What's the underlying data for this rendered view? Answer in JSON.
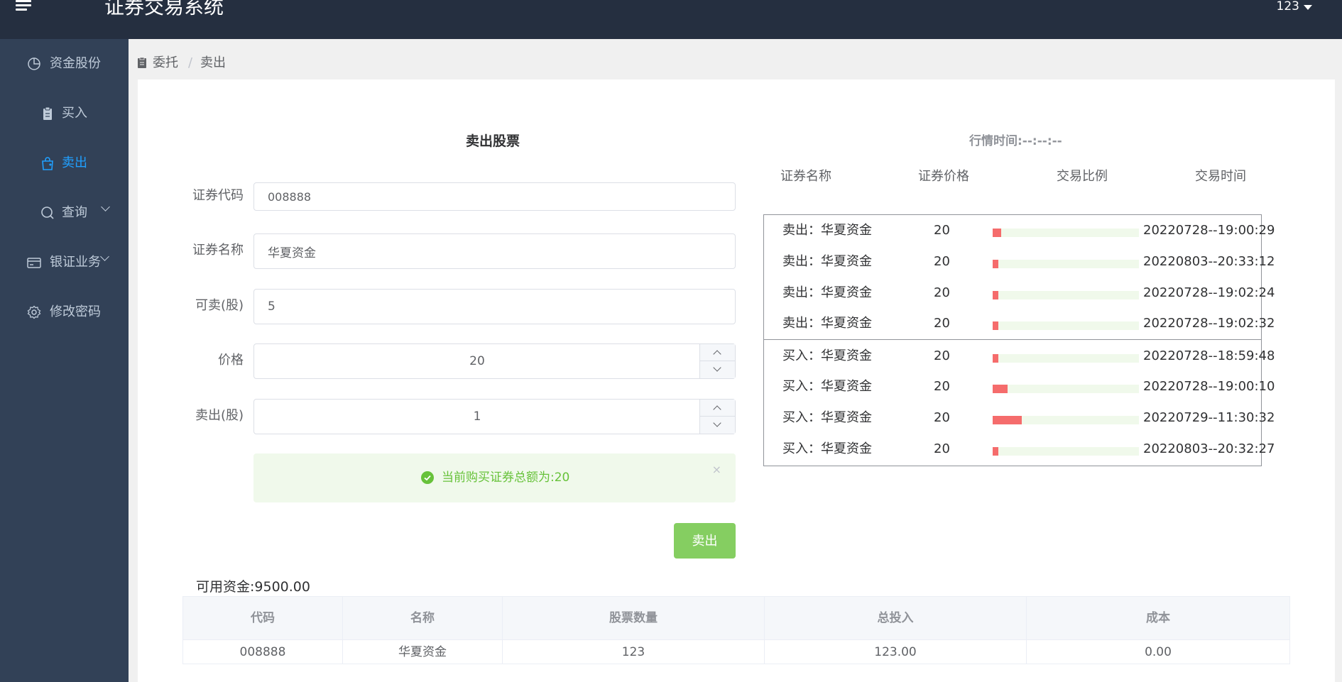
{
  "header": {
    "app_title": "证券交易系统",
    "user_name": "123"
  },
  "sidebar": {
    "items": [
      {
        "label": "资金股份",
        "icon": "pie-chart-icon"
      },
      {
        "label": "买入",
        "icon": "clipboard-icon"
      },
      {
        "label": "卖出",
        "icon": "shopping-bag-icon",
        "active": true
      },
      {
        "label": "查询",
        "icon": "search-icon",
        "has_submenu": true
      },
      {
        "label": "银证业务",
        "icon": "bank-card-icon",
        "has_submenu": true
      },
      {
        "label": "修改密码",
        "icon": "gear-icon"
      }
    ]
  },
  "breadcrumb": {
    "items": [
      "委托",
      "卖出"
    ],
    "separator": "/"
  },
  "form": {
    "title": "卖出股票",
    "code_label": "证券代码",
    "code_value": "008888",
    "name_label": "证券名称",
    "name_value": "华夏资金",
    "available_label": "可卖(股)",
    "available_value": "5",
    "price_label": "价格",
    "price_value": "20",
    "quantity_label": "卖出(股)",
    "quantity_value": "1",
    "alert_text": "当前购买证券总额为:20",
    "alert_close": "×",
    "sell_button": "卖出"
  },
  "funds": {
    "text": "可用资金:9500.00"
  },
  "holdings": {
    "columns": [
      "代码",
      "名称",
      "股票数量",
      "总投入",
      "成本"
    ],
    "rows": [
      [
        "008888",
        "华夏资金",
        "123",
        "123.00",
        "0.00"
      ]
    ]
  },
  "market": {
    "title": "行情时间:--:--:--",
    "columns": [
      "证券名称",
      "证券价格",
      "交易比例",
      "交易时间"
    ],
    "sell_rows": [
      {
        "name": "卖出：华夏资金",
        "price": "20",
        "ratio": 0.012,
        "time": "20220728--19:00:29"
      },
      {
        "name": "卖出：华夏资金",
        "price": "20",
        "ratio": 0.008,
        "time": "20220803--20:33:12"
      },
      {
        "name": "卖出：华夏资金",
        "price": "20",
        "ratio": 0.008,
        "time": "20220728--19:02:24"
      },
      {
        "name": "卖出：华夏资金",
        "price": "20",
        "ratio": 0.008,
        "time": "20220728--19:02:32"
      }
    ],
    "buy_rows": [
      {
        "name": "买入：华夏资金",
        "price": "20",
        "ratio": 0.008,
        "time": "20220728--18:59:48"
      },
      {
        "name": "买入：华夏资金",
        "price": "20",
        "ratio": 0.02,
        "time": "20220728--19:00:10"
      },
      {
        "name": "买入：华夏资金",
        "price": "20",
        "ratio": 0.04,
        "time": "20220729--11:30:32"
      },
      {
        "name": "买入：华夏资金",
        "price": "20",
        "ratio": 0.008,
        "time": "20220803--20:32:27"
      }
    ],
    "bar_fill_color": "#f56c6c",
    "bar_track_color": "#f0f9eb"
  },
  "colors": {
    "header_bg": "#252f40",
    "sidebar_bg": "#324157",
    "active_color": "#20a0ff",
    "success": "#67c23a",
    "button": "#85ce61"
  }
}
